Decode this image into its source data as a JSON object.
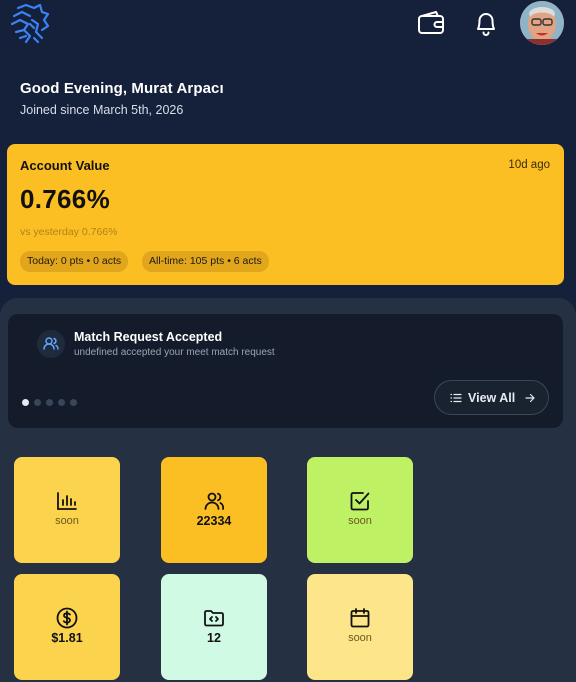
{
  "header": {
    "greeting": "Good Evening, Murat Arpacı",
    "joined": "Joined since March 5th, 2026"
  },
  "account": {
    "label": "Account Value",
    "ago": "10d ago",
    "value": "0.766%",
    "vs": "vs yesterday 0.766%",
    "today": "Today: 0 pts • 0 acts",
    "alltime": "All-time: 105 pts • 6 acts",
    "color": "#fbbf24"
  },
  "notification": {
    "title": "Match Request Accepted",
    "subtitle": "undefined accepted your meet match request",
    "view_all": "View All",
    "active_dot": 0,
    "dot_count": 5
  },
  "tiles": [
    {
      "icon": "bar-chart-icon",
      "text": "soon",
      "color": "#fcd34d"
    },
    {
      "icon": "users-icon",
      "text": "22334",
      "color": "#fbbf24"
    },
    {
      "icon": "check-square-icon",
      "text": "soon",
      "color": "#bef264"
    },
    {
      "icon": "dollar-circle-icon",
      "text": "$1.81",
      "color": "#fcd34d"
    },
    {
      "icon": "code-folder-icon",
      "text": "12",
      "color": "#d1fae5"
    },
    {
      "icon": "calendar-icon",
      "text": "soon",
      "color": "#fde68a"
    }
  ]
}
